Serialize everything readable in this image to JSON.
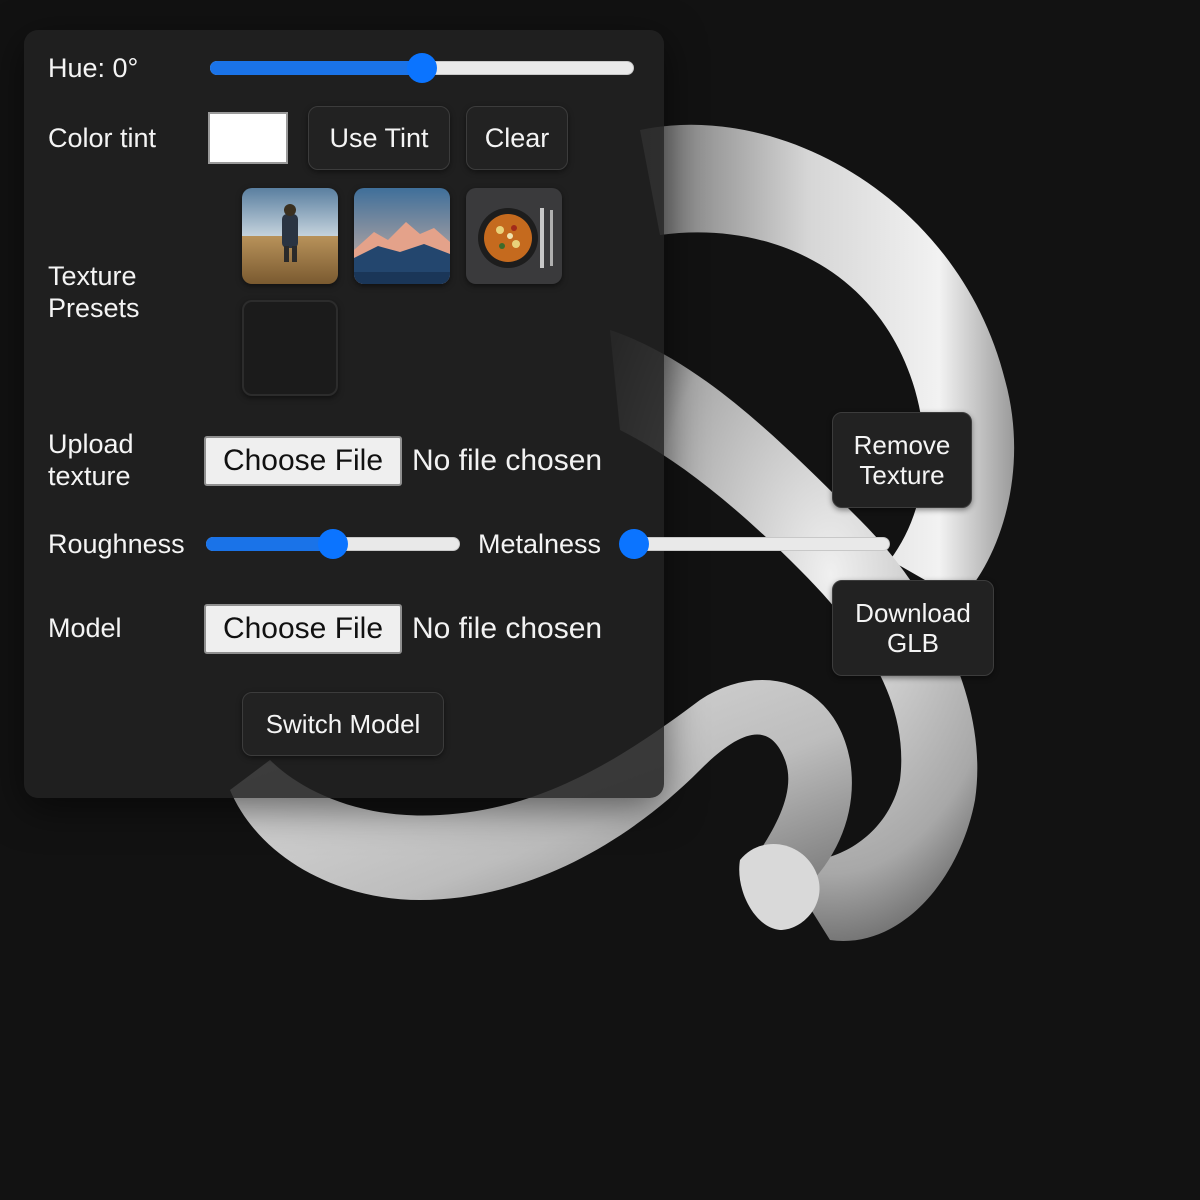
{
  "panel": {
    "hue": {
      "label": "Hue: 0°",
      "value_fraction": 0.5
    },
    "tint": {
      "label": "Color tint",
      "swatch_color": "#ffffff",
      "use_tint_label": "Use Tint",
      "clear_label": "Clear"
    },
    "presets": {
      "label": "Texture Presets",
      "items": [
        "field-photo",
        "mountain-photo",
        "paella-photo",
        "empty"
      ]
    },
    "upload": {
      "label_line1": "Upload",
      "label_line2": "texture",
      "button_label": "Choose File",
      "status": "No file chosen"
    },
    "roughness": {
      "label": "Roughness",
      "value_fraction": 0.5
    },
    "metalness": {
      "label": "Metalness",
      "value_fraction": 0.0
    },
    "model": {
      "label": "Model",
      "button_label": "Choose File",
      "status": "No file chosen"
    },
    "switch_model_label": "Switch Model"
  },
  "actions": {
    "remove_texture": {
      "line1": "Remove",
      "line2": "Texture"
    },
    "download_glb": {
      "line1": "Download",
      "line2": "GLB"
    }
  },
  "colors": {
    "background": "#121212",
    "panel": "#222222",
    "accent": "#0b74ff",
    "model_surface": "#cfcfcf"
  }
}
